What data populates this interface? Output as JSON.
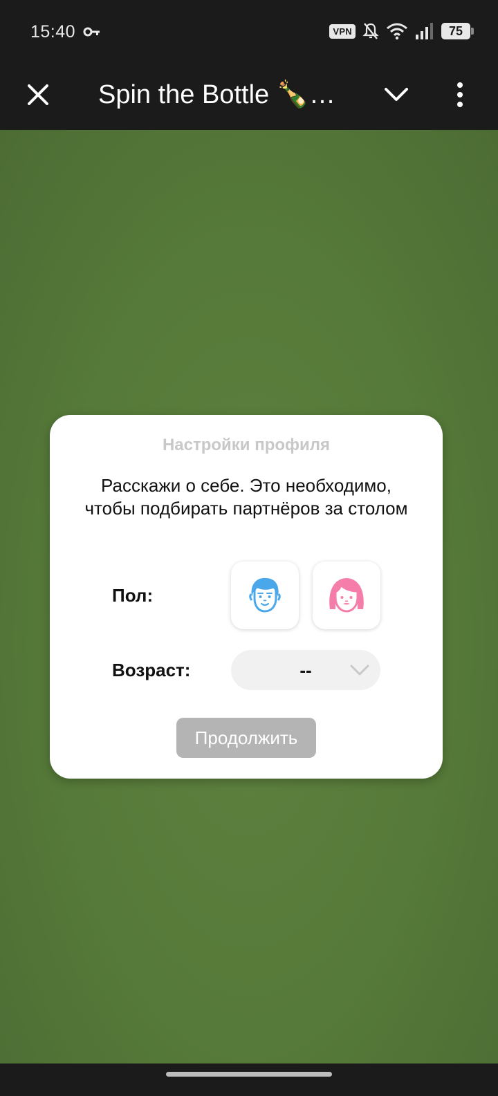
{
  "status_bar": {
    "time": "15:40",
    "vpn": "VPN",
    "battery": "75",
    "icons": [
      "key-icon",
      "vpn-badge",
      "bell-off-icon",
      "wifi-icon",
      "signal-icon",
      "battery-icon"
    ]
  },
  "toolbar": {
    "title": "Spin the Bottle 🍾…",
    "icons": [
      "close-icon",
      "chevron-down-icon",
      "more-vert-icon"
    ]
  },
  "dialog": {
    "title": "Настройки профиля",
    "description": "Расскажи о себе. Это необходимо, чтобы подбирать партнёров за столом",
    "gender_label": "Пол:",
    "age_label": "Возраст:",
    "age_value": "--",
    "continue_label": "Продолжить",
    "colors": {
      "male": "#4aa8ea",
      "female": "#f47ea9",
      "button_disabled": "#b4b4b4"
    }
  },
  "colors": {
    "background": "#567a39",
    "bars": "#1b1b1b"
  }
}
